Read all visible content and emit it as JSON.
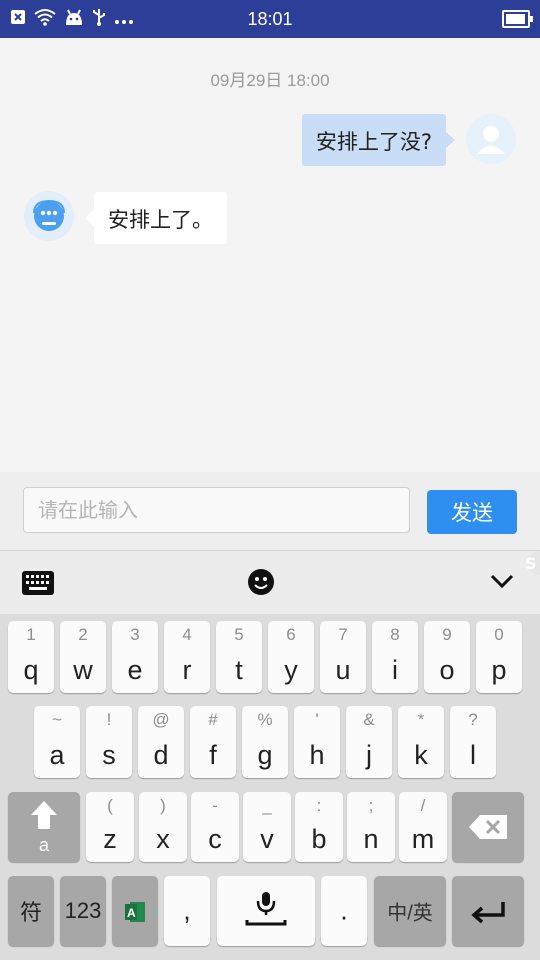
{
  "status_bar": {
    "time": "18:01",
    "icons": [
      "close-box-icon",
      "wifi-icon",
      "android-icon",
      "usb-icon",
      "more-dots-icon",
      "battery-icon"
    ]
  },
  "chat": {
    "timestamp": "09月29日 18:00",
    "messages": [
      {
        "sender": "user",
        "text": "安排上了没?"
      },
      {
        "sender": "bot",
        "text": "安排上了。"
      }
    ]
  },
  "composer": {
    "placeholder": "请在此输入",
    "value": "",
    "send_label": "发送"
  },
  "ime_toolbar": {
    "icons": [
      "keyboard-icon",
      "emoji-icon",
      "chevron-down-icon",
      "sogou-logo-icon"
    ]
  },
  "keyboard": {
    "row1": [
      {
        "hint": "1",
        "key": "q"
      },
      {
        "hint": "2",
        "key": "w"
      },
      {
        "hint": "3",
        "key": "e"
      },
      {
        "hint": "4",
        "key": "r"
      },
      {
        "hint": "5",
        "key": "t"
      },
      {
        "hint": "6",
        "key": "y"
      },
      {
        "hint": "7",
        "key": "u"
      },
      {
        "hint": "8",
        "key": "i"
      },
      {
        "hint": "9",
        "key": "o"
      },
      {
        "hint": "0",
        "key": "p"
      }
    ],
    "row2": [
      {
        "hint": "~",
        "key": "a"
      },
      {
        "hint": "!",
        "key": "s"
      },
      {
        "hint": "@",
        "key": "d"
      },
      {
        "hint": "#",
        "key": "f"
      },
      {
        "hint": "%",
        "key": "g"
      },
      {
        "hint": "'",
        "key": "h"
      },
      {
        "hint": "&",
        "key": "j"
      },
      {
        "hint": "*",
        "key": "k"
      },
      {
        "hint": "?",
        "key": "l"
      }
    ],
    "row3": [
      {
        "hint": "(",
        "key": "z"
      },
      {
        "hint": ")",
        "key": "x"
      },
      {
        "hint": "-",
        "key": "c"
      },
      {
        "hint": "_",
        "key": "v"
      },
      {
        "hint": ":",
        "key": "b"
      },
      {
        "hint": ";",
        "key": "n"
      },
      {
        "hint": "/",
        "key": "m"
      }
    ],
    "shift_label": "a",
    "symbols_label": "符",
    "numbers_label": "123",
    "comma_label": ",",
    "period_label": ".",
    "lang_label": "中/英",
    "icons": [
      "shift-icon",
      "backspace-icon",
      "excel-app-icon",
      "microphone-icon",
      "enter-icon"
    ]
  }
}
